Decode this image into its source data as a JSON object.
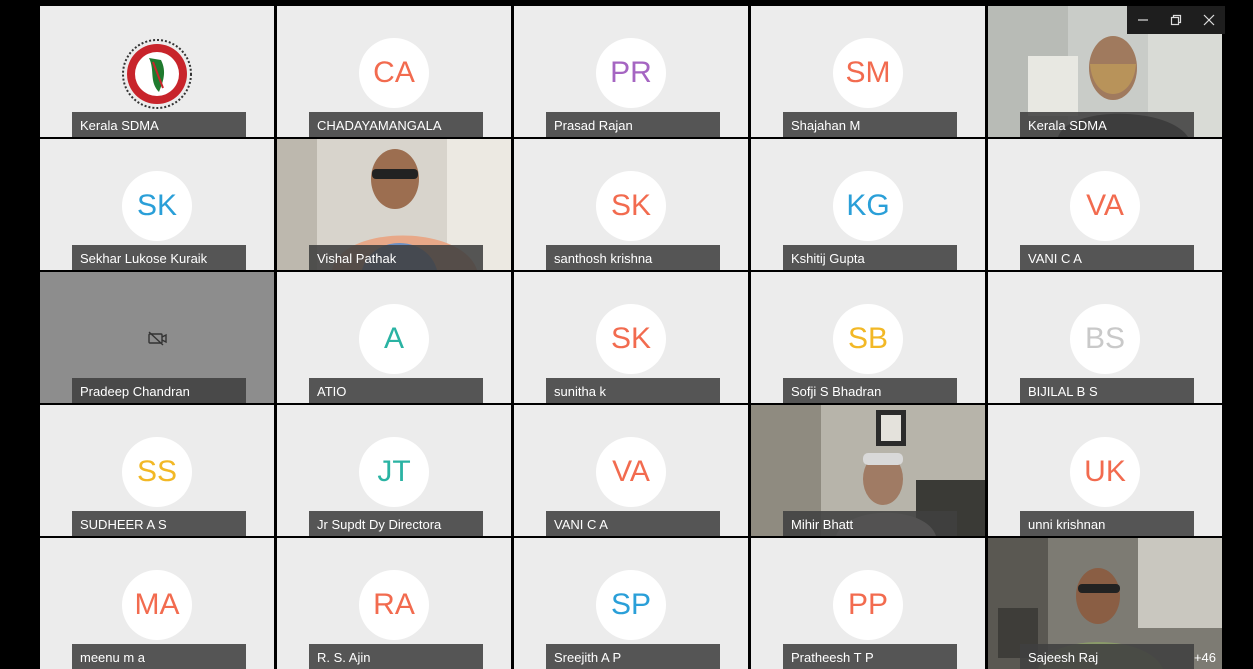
{
  "window": {
    "minimize_icon": "minimize-icon",
    "restore_icon": "restore-icon",
    "close_icon": "close-icon"
  },
  "participants": [
    {
      "name": "Kerala SDMA",
      "type": "logo"
    },
    {
      "name": "CHADAYAMANGALA",
      "initials": "CA",
      "color": "#f26b4f"
    },
    {
      "name": "Prasad Rajan",
      "initials": "PR",
      "color": "#a565c2"
    },
    {
      "name": "Shajahan M",
      "initials": "SM",
      "color": "#f26b4f"
    },
    {
      "name": "Kerala SDMA",
      "type": "video"
    },
    {
      "name": "Sekhar Lukose Kuraik",
      "initials": "SK",
      "color": "#2a9fd8"
    },
    {
      "name": "Vishal Pathak",
      "type": "video"
    },
    {
      "name": "santhosh krishna",
      "initials": "SK",
      "color": "#f26b4f"
    },
    {
      "name": "Kshitij Gupta",
      "initials": "KG",
      "color": "#2a9fd8"
    },
    {
      "name": "VANI C A",
      "initials": "VA",
      "color": "#f26b4f"
    },
    {
      "name": "Pradeep Chandran",
      "type": "camera-off"
    },
    {
      "name": "ATIO",
      "initials": "A",
      "color": "#2ab3a3"
    },
    {
      "name": "sunitha k",
      "initials": "SK",
      "color": "#f26b4f"
    },
    {
      "name": "Sofji S Bhadran",
      "initials": "SB",
      "color": "#f2b826"
    },
    {
      "name": "BIJILAL B S",
      "initials": "BS",
      "color": "#c9c9c9"
    },
    {
      "name": "SUDHEER A S",
      "initials": "SS",
      "color": "#f2b826"
    },
    {
      "name": "Jr Supdt Dy Directora",
      "initials": "JT",
      "color": "#2ab3a3"
    },
    {
      "name": "VANI C A",
      "initials": "VA",
      "color": "#f26b4f"
    },
    {
      "name": "Mihir Bhatt",
      "type": "video"
    },
    {
      "name": "unni krishnan",
      "initials": "UK",
      "color": "#f26b4f"
    },
    {
      "name": "meenu m a",
      "initials": "MA",
      "color": "#f26b4f"
    },
    {
      "name": "R. S. Ajin",
      "initials": "RA",
      "color": "#f26b4f"
    },
    {
      "name": "Sreejith A P",
      "initials": "SP",
      "color": "#2a9fd8"
    },
    {
      "name": "Pratheesh T P",
      "initials": "PP",
      "color": "#f26b4f"
    },
    {
      "name": "Sajeesh Raj",
      "type": "video",
      "more": "+46"
    }
  ]
}
